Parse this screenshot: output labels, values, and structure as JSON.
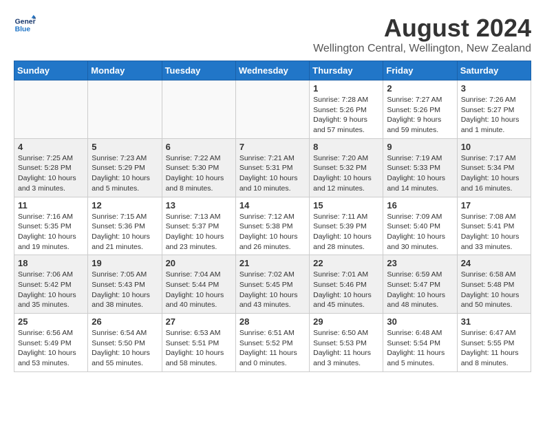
{
  "header": {
    "logo_line1": "General",
    "logo_line2": "Blue",
    "main_title": "August 2024",
    "subtitle": "Wellington Central, Wellington, New Zealand"
  },
  "calendar": {
    "days_of_week": [
      "Sunday",
      "Monday",
      "Tuesday",
      "Wednesday",
      "Thursday",
      "Friday",
      "Saturday"
    ],
    "weeks": [
      {
        "alt": false,
        "days": [
          {
            "num": "",
            "info": ""
          },
          {
            "num": "",
            "info": ""
          },
          {
            "num": "",
            "info": ""
          },
          {
            "num": "",
            "info": ""
          },
          {
            "num": "1",
            "info": "Sunrise: 7:28 AM\nSunset: 5:26 PM\nDaylight: 9 hours\nand 57 minutes."
          },
          {
            "num": "2",
            "info": "Sunrise: 7:27 AM\nSunset: 5:26 PM\nDaylight: 9 hours\nand 59 minutes."
          },
          {
            "num": "3",
            "info": "Sunrise: 7:26 AM\nSunset: 5:27 PM\nDaylight: 10 hours\nand 1 minute."
          }
        ]
      },
      {
        "alt": true,
        "days": [
          {
            "num": "4",
            "info": "Sunrise: 7:25 AM\nSunset: 5:28 PM\nDaylight: 10 hours\nand 3 minutes."
          },
          {
            "num": "5",
            "info": "Sunrise: 7:23 AM\nSunset: 5:29 PM\nDaylight: 10 hours\nand 5 minutes."
          },
          {
            "num": "6",
            "info": "Sunrise: 7:22 AM\nSunset: 5:30 PM\nDaylight: 10 hours\nand 8 minutes."
          },
          {
            "num": "7",
            "info": "Sunrise: 7:21 AM\nSunset: 5:31 PM\nDaylight: 10 hours\nand 10 minutes."
          },
          {
            "num": "8",
            "info": "Sunrise: 7:20 AM\nSunset: 5:32 PM\nDaylight: 10 hours\nand 12 minutes."
          },
          {
            "num": "9",
            "info": "Sunrise: 7:19 AM\nSunset: 5:33 PM\nDaylight: 10 hours\nand 14 minutes."
          },
          {
            "num": "10",
            "info": "Sunrise: 7:17 AM\nSunset: 5:34 PM\nDaylight: 10 hours\nand 16 minutes."
          }
        ]
      },
      {
        "alt": false,
        "days": [
          {
            "num": "11",
            "info": "Sunrise: 7:16 AM\nSunset: 5:35 PM\nDaylight: 10 hours\nand 19 minutes."
          },
          {
            "num": "12",
            "info": "Sunrise: 7:15 AM\nSunset: 5:36 PM\nDaylight: 10 hours\nand 21 minutes."
          },
          {
            "num": "13",
            "info": "Sunrise: 7:13 AM\nSunset: 5:37 PM\nDaylight: 10 hours\nand 23 minutes."
          },
          {
            "num": "14",
            "info": "Sunrise: 7:12 AM\nSunset: 5:38 PM\nDaylight: 10 hours\nand 26 minutes."
          },
          {
            "num": "15",
            "info": "Sunrise: 7:11 AM\nSunset: 5:39 PM\nDaylight: 10 hours\nand 28 minutes."
          },
          {
            "num": "16",
            "info": "Sunrise: 7:09 AM\nSunset: 5:40 PM\nDaylight: 10 hours\nand 30 minutes."
          },
          {
            "num": "17",
            "info": "Sunrise: 7:08 AM\nSunset: 5:41 PM\nDaylight: 10 hours\nand 33 minutes."
          }
        ]
      },
      {
        "alt": true,
        "days": [
          {
            "num": "18",
            "info": "Sunrise: 7:06 AM\nSunset: 5:42 PM\nDaylight: 10 hours\nand 35 minutes."
          },
          {
            "num": "19",
            "info": "Sunrise: 7:05 AM\nSunset: 5:43 PM\nDaylight: 10 hours\nand 38 minutes."
          },
          {
            "num": "20",
            "info": "Sunrise: 7:04 AM\nSunset: 5:44 PM\nDaylight: 10 hours\nand 40 minutes."
          },
          {
            "num": "21",
            "info": "Sunrise: 7:02 AM\nSunset: 5:45 PM\nDaylight: 10 hours\nand 43 minutes."
          },
          {
            "num": "22",
            "info": "Sunrise: 7:01 AM\nSunset: 5:46 PM\nDaylight: 10 hours\nand 45 minutes."
          },
          {
            "num": "23",
            "info": "Sunrise: 6:59 AM\nSunset: 5:47 PM\nDaylight: 10 hours\nand 48 minutes."
          },
          {
            "num": "24",
            "info": "Sunrise: 6:58 AM\nSunset: 5:48 PM\nDaylight: 10 hours\nand 50 minutes."
          }
        ]
      },
      {
        "alt": false,
        "days": [
          {
            "num": "25",
            "info": "Sunrise: 6:56 AM\nSunset: 5:49 PM\nDaylight: 10 hours\nand 53 minutes."
          },
          {
            "num": "26",
            "info": "Sunrise: 6:54 AM\nSunset: 5:50 PM\nDaylight: 10 hours\nand 55 minutes."
          },
          {
            "num": "27",
            "info": "Sunrise: 6:53 AM\nSunset: 5:51 PM\nDaylight: 10 hours\nand 58 minutes."
          },
          {
            "num": "28",
            "info": "Sunrise: 6:51 AM\nSunset: 5:52 PM\nDaylight: 11 hours\nand 0 minutes."
          },
          {
            "num": "29",
            "info": "Sunrise: 6:50 AM\nSunset: 5:53 PM\nDaylight: 11 hours\nand 3 minutes."
          },
          {
            "num": "30",
            "info": "Sunrise: 6:48 AM\nSunset: 5:54 PM\nDaylight: 11 hours\nand 5 minutes."
          },
          {
            "num": "31",
            "info": "Sunrise: 6:47 AM\nSunset: 5:55 PM\nDaylight: 11 hours\nand 8 minutes."
          }
        ]
      }
    ]
  }
}
